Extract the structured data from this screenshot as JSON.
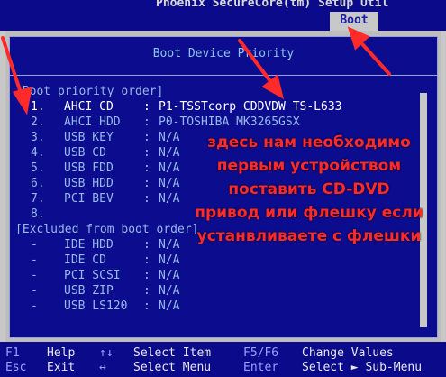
{
  "window": {
    "title": "Phoenix SecureCore(tm) Setup Util",
    "active_tab": "Boot"
  },
  "panel": {
    "title": "Boot Device Priority"
  },
  "priority_section": {
    "header": "[Boot priority order]",
    "items": [
      {
        "index": "1.",
        "name": "AHCI CD",
        "value": "P1-TSSTcorp CDDVDW TS-L633",
        "selected": true
      },
      {
        "index": "2.",
        "name": "AHCI HDD",
        "value": "P0-TOSHIBA MK3265GSX",
        "selected": false
      },
      {
        "index": "3.",
        "name": "USB KEY",
        "value": "N/A",
        "selected": false
      },
      {
        "index": "4.",
        "name": "USB CD",
        "value": "N/A",
        "selected": false
      },
      {
        "index": "5.",
        "name": "USB FDD",
        "value": "N/A",
        "selected": false
      },
      {
        "index": "6.",
        "name": "USB HDD",
        "value": "N/A",
        "selected": false
      },
      {
        "index": "7.",
        "name": "PCI BEV",
        "value": "N/A",
        "selected": false
      },
      {
        "index": "8.",
        "name": "",
        "value": "",
        "selected": false
      }
    ]
  },
  "excluded_section": {
    "header": "[Excluded from boot order]",
    "items": [
      {
        "index": "-",
        "name": "IDE HDD",
        "value": "N/A"
      },
      {
        "index": "-",
        "name": "IDE CD",
        "value": "N/A"
      },
      {
        "index": "-",
        "name": "PCI SCSI",
        "value": "N/A"
      },
      {
        "index": "-",
        "name": "USB ZIP",
        "value": "N/A"
      },
      {
        "index": "-",
        "name": "USB LS120",
        "value": "N/A"
      }
    ]
  },
  "annotation": {
    "lines": [
      "здесь нам необходимо",
      "первым устройством",
      "поставить CD-DVD",
      "привод или флешку если",
      "устанвливаете с флешки"
    ],
    "color": "#ff2a2a"
  },
  "footer": {
    "row1": [
      {
        "key": "F1",
        "label": "Help"
      },
      {
        "key": "↑↓",
        "label": "Select Item"
      },
      {
        "key": "F5/F6",
        "label": "Change Values"
      }
    ],
    "row2": [
      {
        "key": "Esc",
        "label": "Exit"
      },
      {
        "key": "↔",
        "label": "Select Menu"
      },
      {
        "key": "Enter",
        "label": "Select ► Sub-Menu"
      }
    ]
  },
  "colors": {
    "background": "#0a0a8a",
    "panel_frame": "#c8c8c8",
    "text_normal": "#98b8ea",
    "text_selected": "#ffffff",
    "arrow": "#ff2a2a"
  }
}
